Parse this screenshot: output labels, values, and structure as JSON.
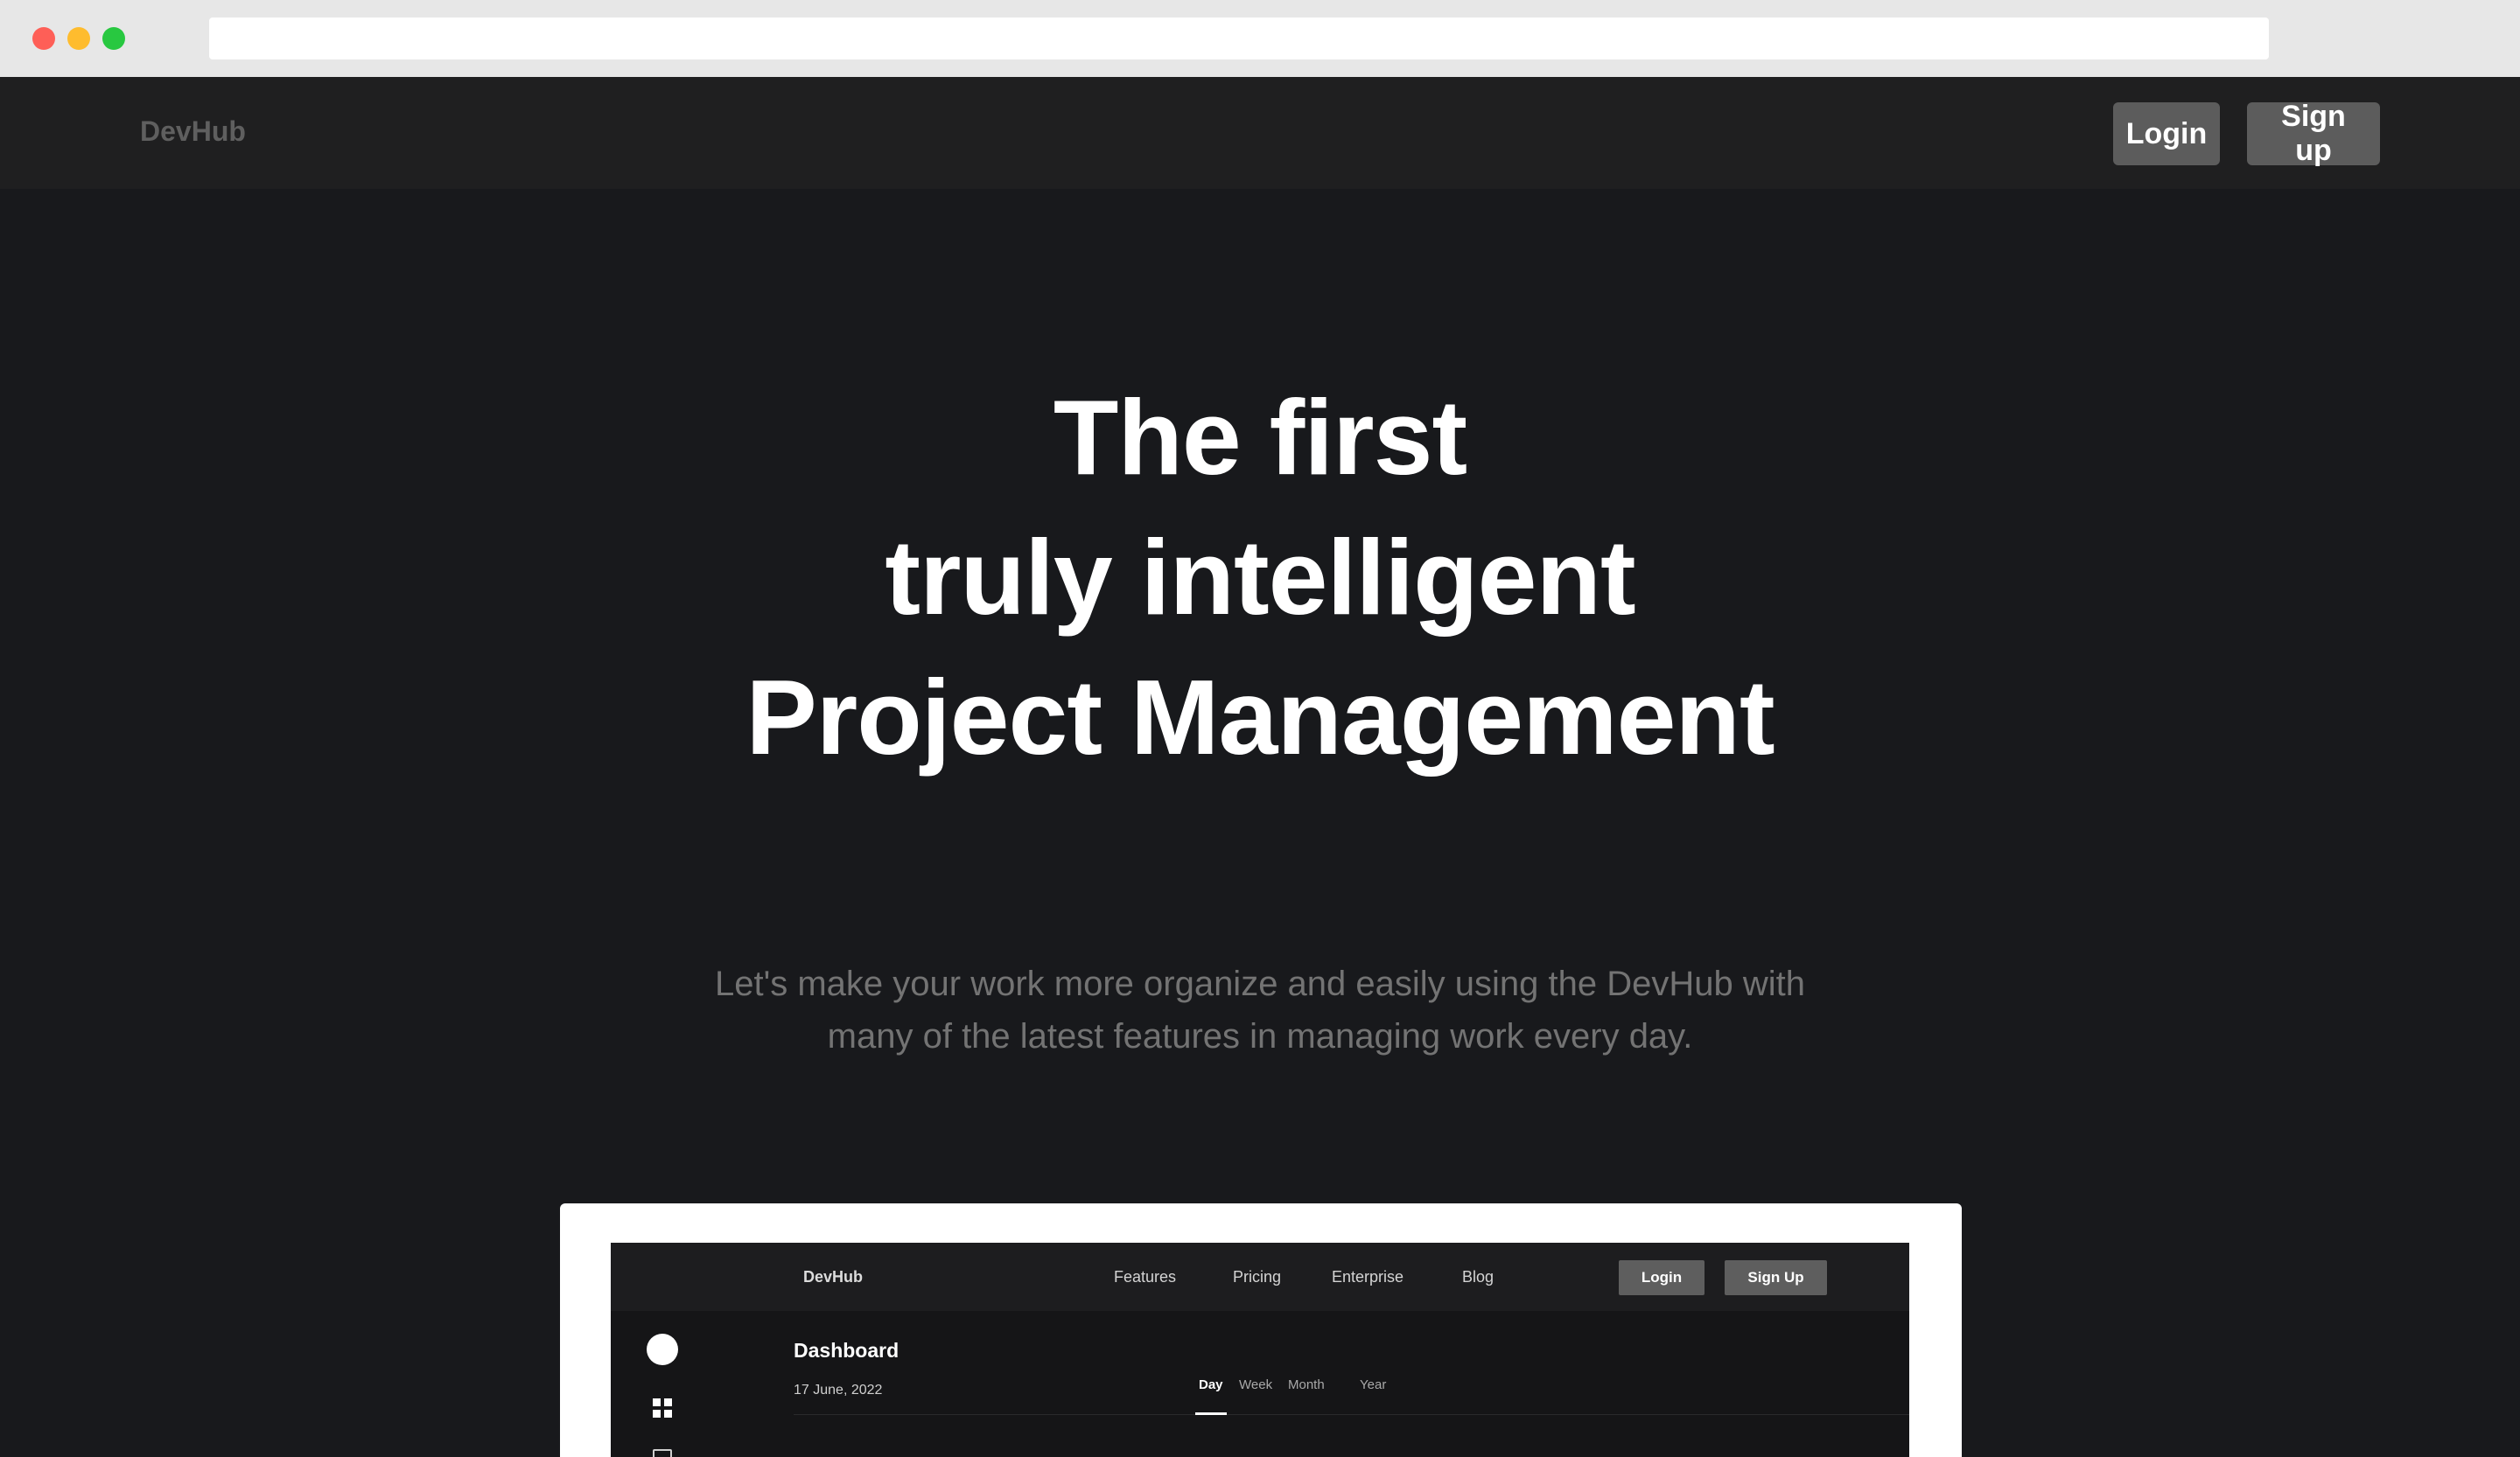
{
  "browser": {
    "url": ""
  },
  "nav": {
    "brand": "DevHub",
    "login_label": "Login",
    "signup_label": "Sign up"
  },
  "hero": {
    "title_lines": [
      "The first",
      "truly intelligent",
      "Project Management"
    ],
    "subtitle_lines": [
      "Let's make your work more organize and easily using the DevHub with",
      "many of the latest features in managing work every day."
    ]
  },
  "preview": {
    "brand": "DevHub",
    "links": [
      "Features",
      "Pricing",
      "Enterprise",
      "Blog"
    ],
    "login_label": "Login",
    "signup_label": "Sign Up",
    "page_title": "Dashboard",
    "date": "17 June, 2022",
    "tabs": [
      "Day",
      "Week",
      "Month",
      "Year"
    ],
    "active_tab": "Day",
    "sidebar_icons": [
      "avatar",
      "grid-icon",
      "calendar-icon"
    ]
  }
}
